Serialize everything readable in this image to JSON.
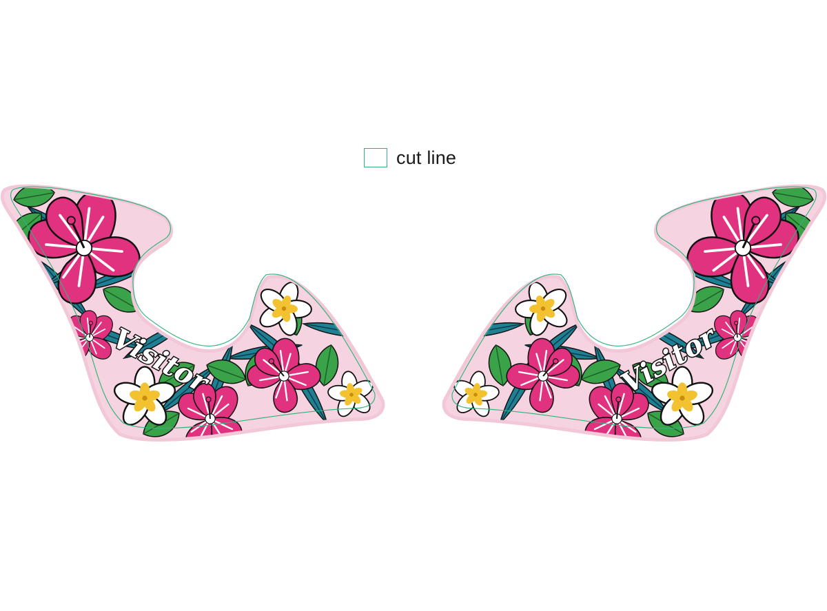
{
  "legend": {
    "label": "cut line",
    "swatch_color": "#2fb37a"
  },
  "decals": [
    {
      "side": "left",
      "brand_text": "Visitor"
    },
    {
      "side": "right",
      "brand_text": "Visitor"
    }
  ],
  "palette": {
    "cut_line": "#2fb37a",
    "bleed": "#f2c8d8",
    "leaf_teal": "#1f7f93",
    "leaf_green": "#3aa34a",
    "hibiscus_pink": "#e0327e",
    "plumeria_yellow": "#f2c230",
    "background_pink": "#f6d3e0"
  }
}
